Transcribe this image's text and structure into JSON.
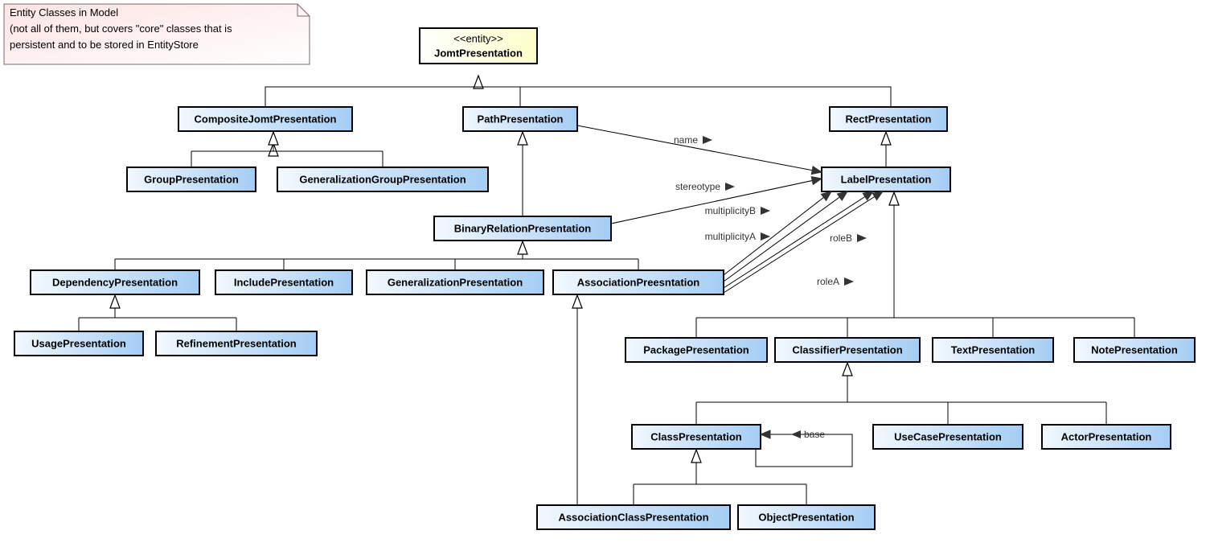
{
  "note": {
    "line1": "Entity Classes in Model",
    "line2": "(not all of them, but covers \"core\" classes that is",
    "line3": "persistent and to be stored in EntityStore"
  },
  "stereotype": "<<entity>>",
  "classes": {
    "JomtPresentation": "JomtPresentation",
    "CompositeJomtPresentation": "CompositeJomtPresentation",
    "PathPresentation": "PathPresentation",
    "RectPresentation": "RectPresentation",
    "GroupPresentation": "GroupPresentation",
    "GeneralizationGroupPresentation": "GeneralizationGroupPresentation",
    "BinaryRelationPresentation": "BinaryRelationPresentation",
    "LabelPresentation": "LabelPresentation",
    "DependencyPresentation": "DependencyPresentation",
    "IncludePresentation": "IncludePresentation",
    "GeneralizationPresentation": "GeneralizationPresentation",
    "AssociationPreesntation": "AssociationPreesntation",
    "UsagePresentation": "UsagePresentation",
    "RefinementPresentation": "RefinementPresentation",
    "PackagePresentation": "PackagePresentation",
    "ClassifierPresentation": "ClassifierPresentation",
    "TextPresentation": "TextPresentation",
    "NotePresentation": "NotePresentation",
    "ClassPresentation": "ClassPresentation",
    "UseCasePresentation": "UseCasePresentation",
    "ActorPresentation": "ActorPresentation",
    "AssociationClassPresentation": "AssociationClassPresentation",
    "ObjectPresentation": "ObjectPresentation"
  },
  "assoc": {
    "name": "name",
    "stereotype": "stereotype",
    "multiplicityB": "multiplicityB",
    "multiplicityA": "multiplicityA",
    "roleB": "roleB",
    "roleA": "roleA",
    "base": "base"
  }
}
